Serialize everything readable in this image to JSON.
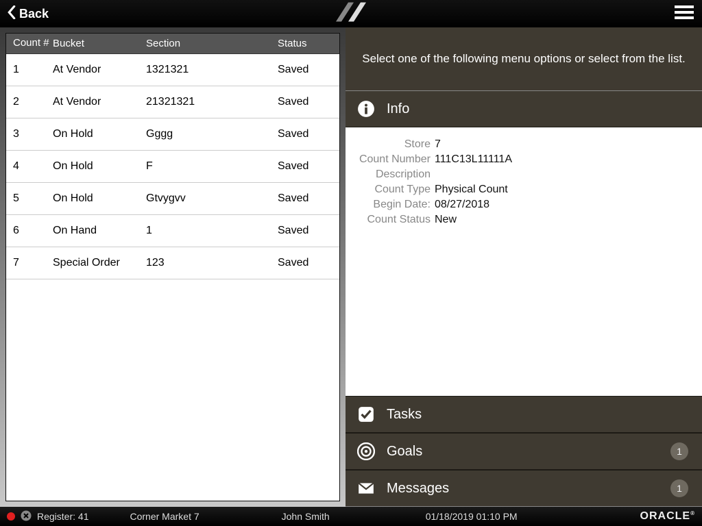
{
  "header": {
    "back_label": "Back"
  },
  "table": {
    "headers": {
      "count": "Count #",
      "bucket": "Bucket",
      "section": "Section",
      "status": "Status"
    },
    "rows": [
      {
        "n": "1",
        "bucket": "At Vendor",
        "section": "1321321",
        "status": "Saved"
      },
      {
        "n": "2",
        "bucket": "At Vendor",
        "section": "21321321",
        "status": "Saved"
      },
      {
        "n": "3",
        "bucket": "On Hold",
        "section": "Gggg",
        "status": "Saved"
      },
      {
        "n": "4",
        "bucket": "On Hold",
        "section": "F",
        "status": "Saved"
      },
      {
        "n": "5",
        "bucket": "On Hold",
        "section": "Gtvygvv",
        "status": "Saved"
      },
      {
        "n": "6",
        "bucket": "On Hand",
        "section": "1",
        "status": "Saved"
      },
      {
        "n": "7",
        "bucket": "Special Order",
        "section": "123",
        "status": "Saved"
      }
    ]
  },
  "right": {
    "prompt": "Select one of the following menu options or select from the list.",
    "sections": {
      "info": {
        "title": "Info"
      },
      "tasks": {
        "title": "Tasks"
      },
      "goals": {
        "title": "Goals",
        "badge": "1"
      },
      "messages": {
        "title": "Messages",
        "badge": "1"
      }
    },
    "info": {
      "store_label": "Store",
      "store": "7",
      "countnum_label": "Count Number",
      "countnum": "111C13L11111A",
      "desc_label": "Description",
      "desc": "",
      "type_label": "Count Type",
      "type": "Physical Count",
      "begin_label": "Begin Date:",
      "begin": "08/27/2018",
      "status_label": "Count Status",
      "status": "New"
    }
  },
  "footer": {
    "register": "Register: 41",
    "store": "Corner Market 7",
    "user": "John Smith",
    "datetime": "01/18/2019 01:10 PM",
    "brand": "ORACLE"
  }
}
